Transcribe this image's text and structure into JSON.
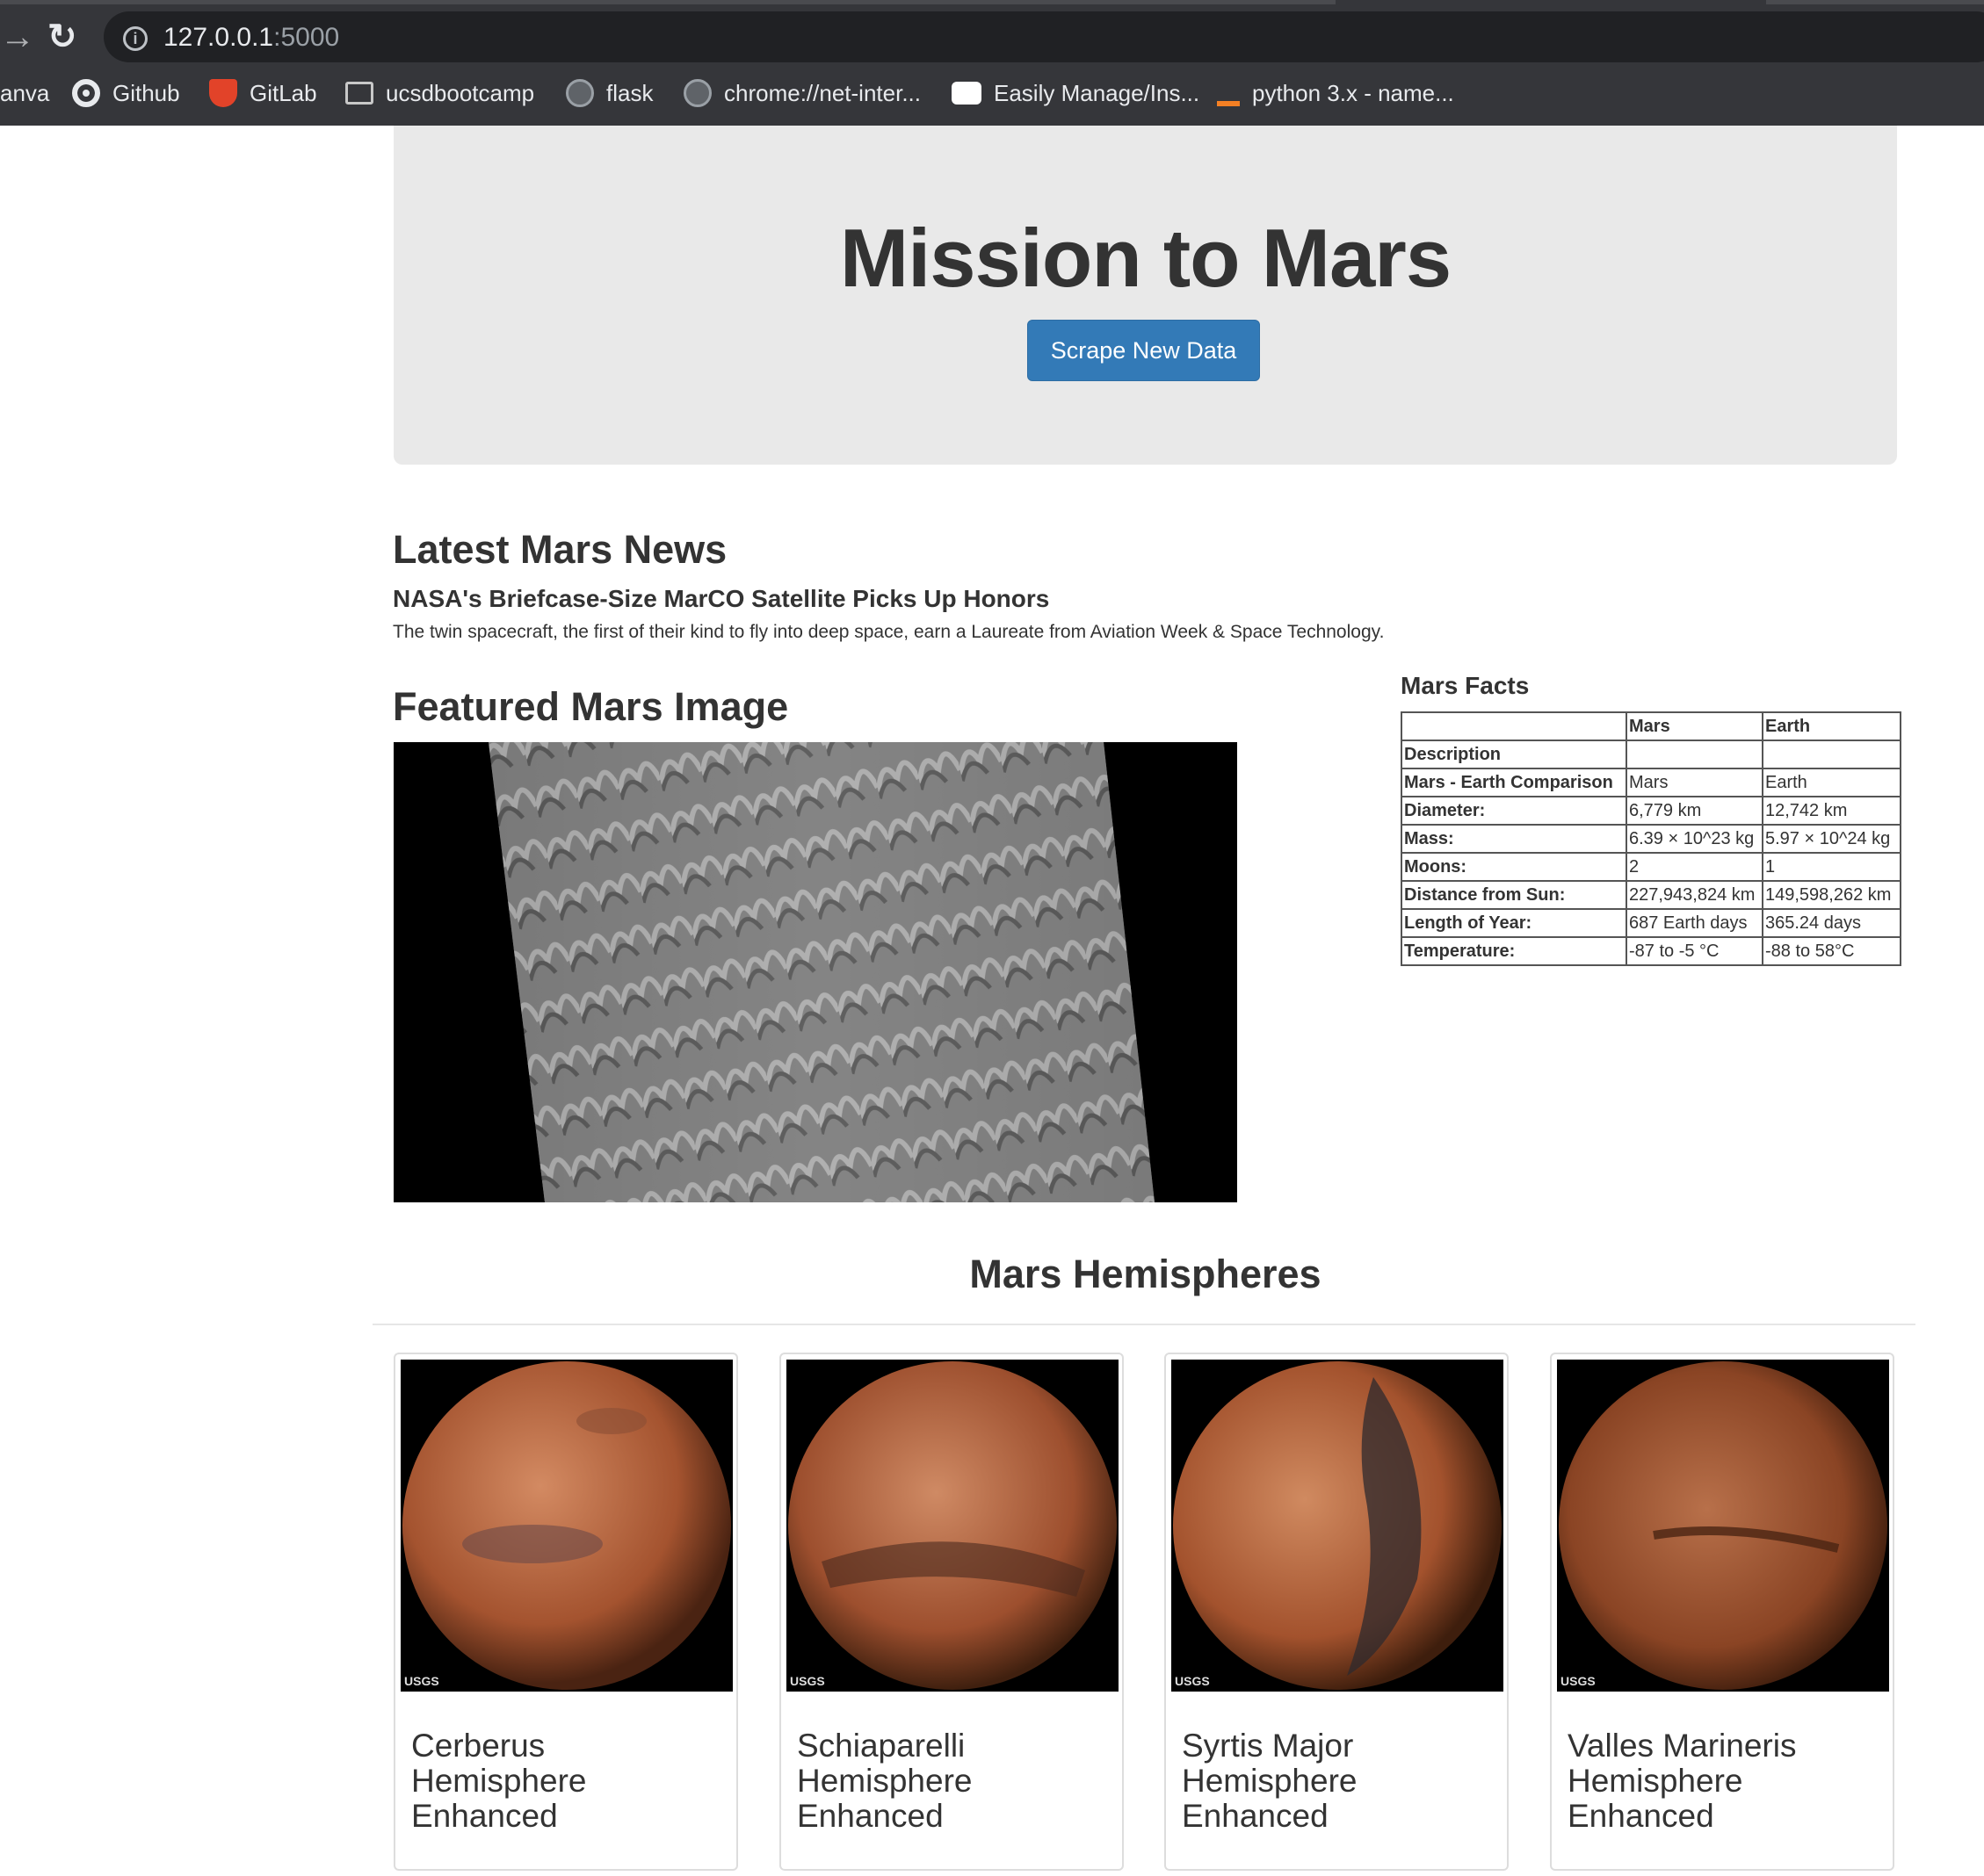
{
  "browser": {
    "url_host": "127.0.0.1",
    "url_port": ":5000",
    "bookmarks": [
      "anva",
      "Github",
      "GitLab",
      "ucsdbootcamp",
      "flask",
      "chrome://net-inter...",
      "Easily Manage/Ins...",
      "python 3.x - name..."
    ]
  },
  "jumbotron": {
    "title": "Mission to Mars",
    "button_label": "Scrape New Data"
  },
  "news": {
    "heading": "Latest Mars News",
    "title": "NASA's Briefcase-Size MarCO Satellite Picks Up Honors",
    "paragraph": "The twin spacecraft, the first of their kind to fly into deep space, earn a Laureate from Aviation Week & Space Technology."
  },
  "featured": {
    "heading": "Featured Mars Image"
  },
  "facts": {
    "heading": "Mars Facts",
    "columns": [
      "",
      "Mars",
      "Earth"
    ],
    "rows": [
      [
        "Description",
        "",
        ""
      ],
      [
        "Mars - Earth Comparison",
        "Mars",
        "Earth"
      ],
      [
        "Diameter:",
        "6,779 km",
        "12,742 km"
      ],
      [
        "Mass:",
        "6.39 × 10^23 kg",
        "5.97 × 10^24 kg"
      ],
      [
        "Moons:",
        "2",
        "1"
      ],
      [
        "Distance from Sun:",
        "227,943,824 km",
        "149,598,262 km"
      ],
      [
        "Length of Year:",
        "687 Earth days",
        "365.24 days"
      ],
      [
        "Temperature:",
        "-87 to -5 °C",
        "-88 to 58°C"
      ]
    ]
  },
  "hemispheres": {
    "heading": "Mars Hemispheres",
    "items": [
      {
        "title": "Cerberus Hemisphere Enhanced",
        "logo": "USGS"
      },
      {
        "title": "Schiaparelli Hemisphere Enhanced",
        "logo": "USGS"
      },
      {
        "title": "Syrtis Major Hemisphere Enhanced",
        "logo": "USGS"
      },
      {
        "title": "Valles Marineris Hemisphere Enhanced",
        "logo": "USGS"
      }
    ]
  },
  "colors": {
    "button": "#337ab7",
    "jumbotron": "#e9e9e9",
    "chrome": "#35363a"
  }
}
